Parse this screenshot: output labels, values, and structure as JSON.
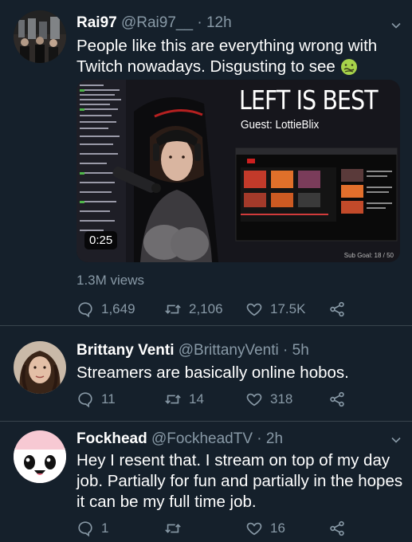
{
  "tweets": [
    {
      "name": "Rai97",
      "handle": "@Rai97__",
      "time": "· 12h",
      "text_line1": "People like this are everything wrong with",
      "text_line2": "Twitch nowadays. Disgusting to see",
      "emoji_icon": "nauseated-face-emoji",
      "media": {
        "headline": "LEFT IS BEST",
        "guest": "Guest: LottieBlix",
        "duration": "0:25",
        "sub_goal": "Sub Goal: 18 / 50"
      },
      "views": "1.3M views",
      "replies": "1,649",
      "retweets": "2,106",
      "likes": "17.5K"
    },
    {
      "name": "Brittany Venti",
      "handle": "@BrittanyVenti",
      "time": "· 5h",
      "text": "Streamers are basically online hobos.",
      "replies": "11",
      "retweets": "14",
      "likes": "318"
    },
    {
      "name": "Fockhead",
      "handle": "@FockheadTV",
      "time": "· 2h",
      "text_line1": "Hey I resent that. I stream on top of my day",
      "text_line2": "job. Partially for fun and partially in the hopes",
      "text_line3": "it can be my full time job.",
      "replies": "1",
      "retweets": "",
      "likes": "16"
    }
  ],
  "colors": {
    "background": "#15202b",
    "secondary_text": "#8899a6",
    "divider": "#38444d"
  }
}
